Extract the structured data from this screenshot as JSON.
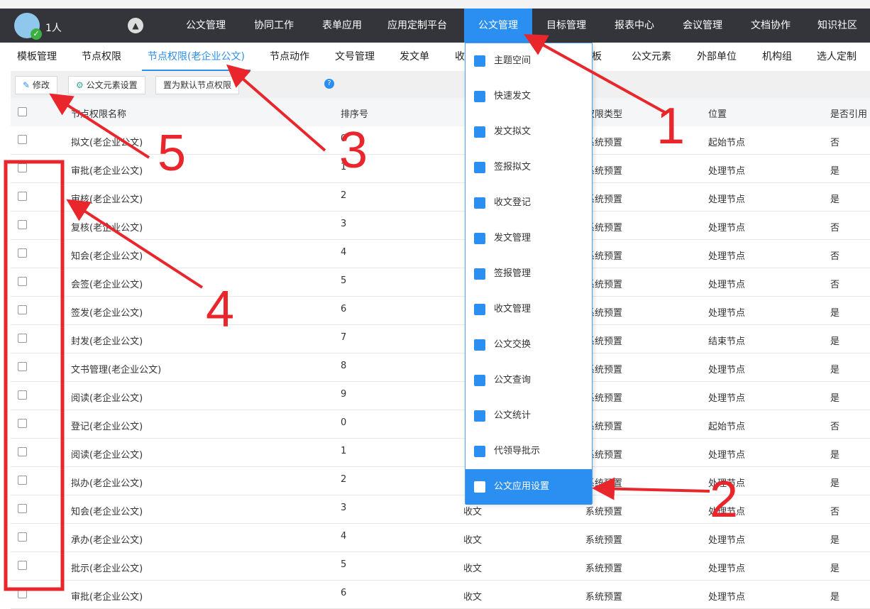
{
  "header": {
    "user_count": "1人",
    "nav": [
      "公文管理",
      "协同工作",
      "表单应用",
      "应用定制平台",
      "公文管理",
      "目标管理",
      "报表中心",
      "会议管理",
      "文档协作",
      "知识社区"
    ],
    "active_index": 4
  },
  "subnav": {
    "tabs": [
      "模板管理",
      "节点权限",
      "节点权限(老企业公文)",
      "节点动作",
      "文号管理",
      "发文单",
      "收",
      "板",
      "公文元素",
      "外部单位",
      "机构组",
      "选人定制"
    ],
    "active_index": 2
  },
  "toolbar": {
    "edit": "修改",
    "element_settings": "公文元素设置",
    "set_default": "置为默认节点权限",
    "help": "?"
  },
  "table": {
    "columns": [
      "节点权限名称",
      "排序号",
      "",
      "权限类型",
      "位置",
      "是否引用"
    ],
    "rows": [
      [
        "拟文(老企业公文)",
        "0",
        "",
        "系统预置",
        "起始节点",
        "否"
      ],
      [
        "审批(老企业公文)",
        "1",
        "",
        "系统预置",
        "处理节点",
        "是"
      ],
      [
        "审核(老企业公文)",
        "2",
        "",
        "系统预置",
        "处理节点",
        "是"
      ],
      [
        "复核(老企业公文)",
        "3",
        "",
        "系统预置",
        "处理节点",
        "否"
      ],
      [
        "知会(老企业公文)",
        "4",
        "",
        "系统预置",
        "处理节点",
        "否"
      ],
      [
        "会签(老企业公文)",
        "5",
        "",
        "系统预置",
        "处理节点",
        "否"
      ],
      [
        "签发(老企业公文)",
        "6",
        "",
        "系统预置",
        "处理节点",
        "是"
      ],
      [
        "封发(老企业公文)",
        "7",
        "",
        "系统预置",
        "结束节点",
        "是"
      ],
      [
        "文书管理(老企业公文)",
        "8",
        "",
        "系统预置",
        "处理节点",
        "是"
      ],
      [
        "阅读(老企业公文)",
        "9",
        "",
        "系统预置",
        "处理节点",
        "是"
      ],
      [
        "登记(老企业公文)",
        "0",
        "",
        "系统预置",
        "起始节点",
        "否"
      ],
      [
        "阅读(老企业公文)",
        "1",
        "",
        "系统预置",
        "处理节点",
        "是"
      ],
      [
        "拟办(老企业公文)",
        "2",
        "",
        "系统预置",
        "处理节点",
        "是"
      ],
      [
        "知会(老企业公文)",
        "3",
        "收文",
        "系统预置",
        "处理节点",
        "否"
      ],
      [
        "承办(老企业公文)",
        "4",
        "收文",
        "系统预置",
        "处理节点",
        "是"
      ],
      [
        "批示(老企业公文)",
        "5",
        "收文",
        "系统预置",
        "处理节点",
        "是"
      ],
      [
        "审批(老企业公文)",
        "6",
        "收文",
        "系统预置",
        "处理节点",
        "是"
      ]
    ]
  },
  "dropdown": {
    "items": [
      "主题空间",
      "快速发文",
      "发文拟文",
      "签报拟文",
      "收文登记",
      "发文管理",
      "签报管理",
      "收文管理",
      "公文交换",
      "公文查询",
      "公文统计",
      "代领导批示",
      "公文应用设置"
    ],
    "highlighted_index": 12
  },
  "annotations": {
    "labels": [
      "1",
      "2",
      "3",
      "4",
      "5"
    ],
    "color": "#e8262b"
  },
  "colors": {
    "accent": "#2b8ff2",
    "nav_bg": "#34353b"
  }
}
